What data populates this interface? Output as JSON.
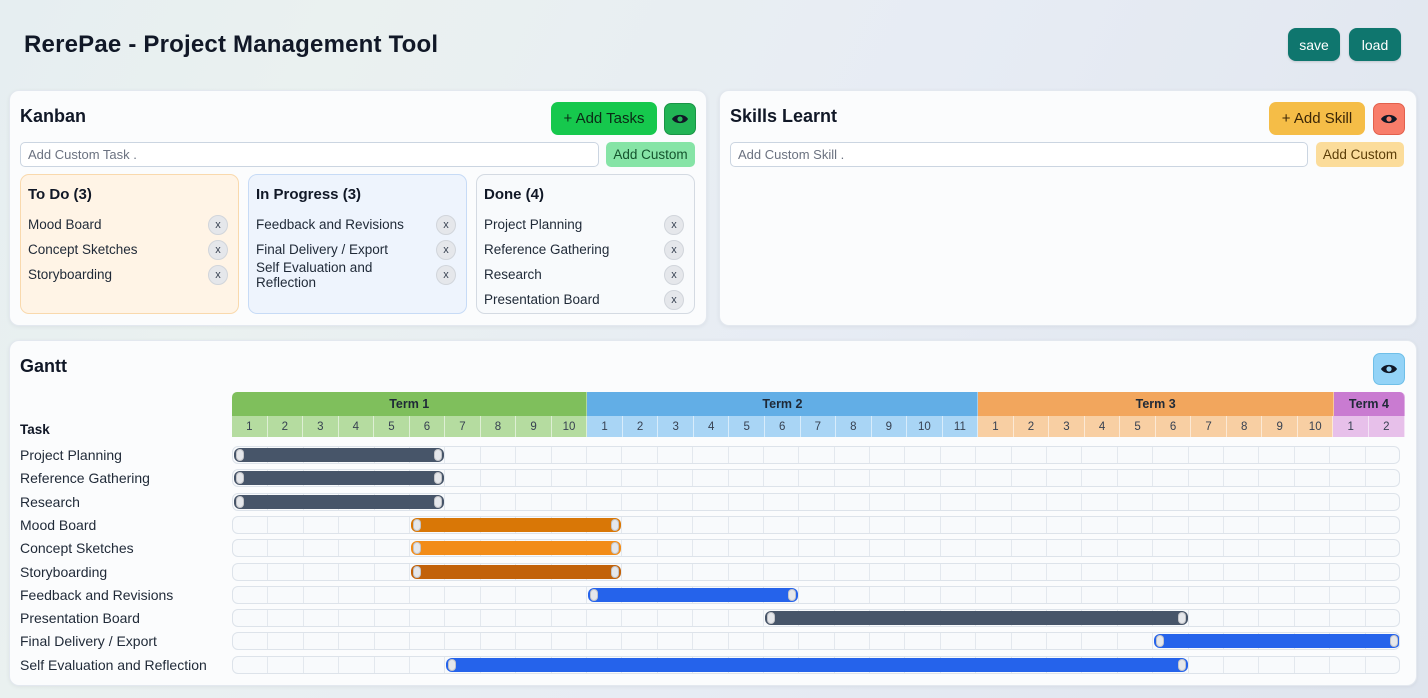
{
  "app": {
    "title": "RerePae - Project Management Tool",
    "save_label": "save",
    "load_label": "load"
  },
  "kanban": {
    "title": "Kanban",
    "add_tasks_label": "+ Add Tasks",
    "input_placeholder": "Add Custom Task .",
    "add_custom_label": "Add Custom",
    "remove_label": "x",
    "columns": [
      {
        "title": "To Do (3)",
        "bg": "#fff4e6",
        "border": "#f9d9ad",
        "items": [
          "Mood Board",
          "Concept Sketches",
          "Storyboarding"
        ]
      },
      {
        "title": "In Progress (3)",
        "bg": "#eef4fd",
        "border": "#c7dbf6",
        "items": [
          "Feedback and Revisions",
          "Final Delivery / Export",
          "Self Evaluation and Reflection"
        ]
      },
      {
        "title": "Done (4)",
        "bg": "#f8fafc",
        "border": "#d4dae2",
        "items": [
          "Project Planning",
          "Reference Gathering",
          "Research",
          "Presentation Board"
        ]
      }
    ]
  },
  "skills": {
    "title": "Skills Learnt",
    "add_skill_label": "+ Add Skill",
    "input_placeholder": "Add Custom Skill .",
    "add_custom_label": "Add Custom"
  },
  "gantt": {
    "title": "Gantt",
    "task_header": "Task",
    "terms": [
      {
        "label": "Term 1",
        "weeks": 10,
        "color": "#7fbf5c",
        "week_color": "#b5dca0"
      },
      {
        "label": "Term 2",
        "weeks": 11,
        "color": "#62aee6",
        "week_color": "#a9d5f5"
      },
      {
        "label": "Term 3",
        "weeks": 10,
        "color": "#f2a65d",
        "week_color": "#f8cfa3"
      },
      {
        "label": "Term 4",
        "weeks": 2,
        "color": "#c97bd1",
        "week_color": "#e7c0ea"
      }
    ],
    "tasks": [
      {
        "name": "Project Planning",
        "start": 0,
        "end": 6,
        "color": "#475569"
      },
      {
        "name": "Reference Gathering",
        "start": 0,
        "end": 6,
        "color": "#475569"
      },
      {
        "name": "Research",
        "start": 0,
        "end": 6,
        "color": "#475569"
      },
      {
        "name": "Mood Board",
        "start": 5,
        "end": 11,
        "color": "#d97706"
      },
      {
        "name": "Concept Sketches",
        "start": 5,
        "end": 11,
        "color": "#f28c18"
      },
      {
        "name": "Storyboarding",
        "start": 5,
        "end": 11,
        "color": "#c2620a"
      },
      {
        "name": "Feedback and Revisions",
        "start": 10,
        "end": 16,
        "color": "#2563eb"
      },
      {
        "name": "Presentation Board",
        "start": 15,
        "end": 27,
        "color": "#475569"
      },
      {
        "name": "Final Delivery / Export",
        "start": 26,
        "end": 33,
        "color": "#2563eb"
      },
      {
        "name": "Self Evaluation and Reflection",
        "start": 6,
        "end": 27,
        "color": "#2563eb"
      }
    ]
  },
  "colors": {
    "save_button": "#0f766e",
    "add_tasks_button": "#16c84d",
    "kanban_eye_button": "#22b455",
    "kanban_add_custom": "#86e4a6",
    "add_skill_button": "#f5bd47",
    "skills_eye_button": "#f87d6a",
    "skills_add_custom": "#fbdc9a",
    "gantt_eye_button": "#93d3f7"
  },
  "icons": {
    "visibility": "eye-icon"
  }
}
